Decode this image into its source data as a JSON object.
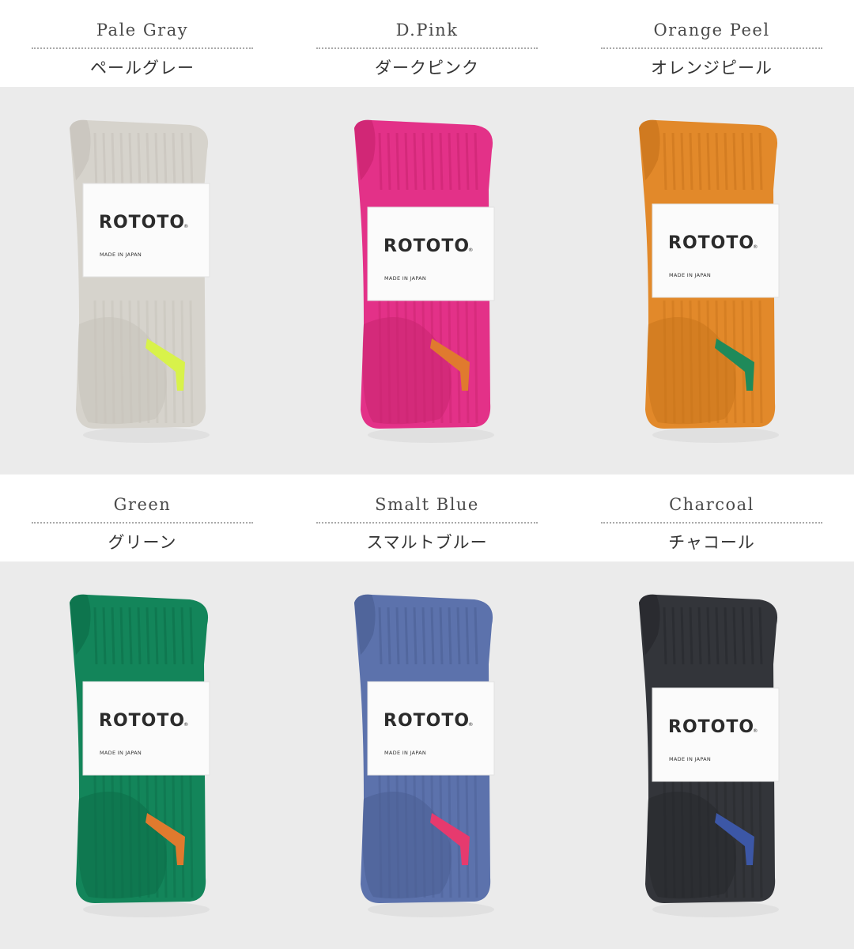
{
  "variants": [
    {
      "name_en": "Pale Gray",
      "name_jp": "ペールグレー",
      "sock_color": "#d6d3cc",
      "rib_color": "#c6c2ba",
      "heel_accent": "#d8f24a"
    },
    {
      "name_en": "D.Pink",
      "name_jp": "ダークピンク",
      "sock_color": "#e33188",
      "rib_color": "#c9246f",
      "heel_accent": "#e07a2e"
    },
    {
      "name_en": "Orange Peel",
      "name_jp": "オレンジピール",
      "sock_color": "#e2892a",
      "rib_color": "#c9741c",
      "heel_accent": "#1f8a5a"
    },
    {
      "name_en": "Green",
      "name_jp": "グリーン",
      "sock_color": "#13855a",
      "rib_color": "#0d6e49",
      "heel_accent": "#e07a2e"
    },
    {
      "name_en": "Smalt Blue",
      "name_jp": "スマルトブルー",
      "sock_color": "#5c72ac",
      "rib_color": "#4b5f94",
      "heel_accent": "#e63a6e"
    },
    {
      "name_en": "Charcoal",
      "name_jp": "チャコール",
      "sock_color": "#33353a",
      "rib_color": "#26282c",
      "heel_accent": "#3c57a6"
    }
  ],
  "band": {
    "brand": "ROTOTO",
    "registered": "®",
    "made_in": "MADE IN JAPAN"
  }
}
